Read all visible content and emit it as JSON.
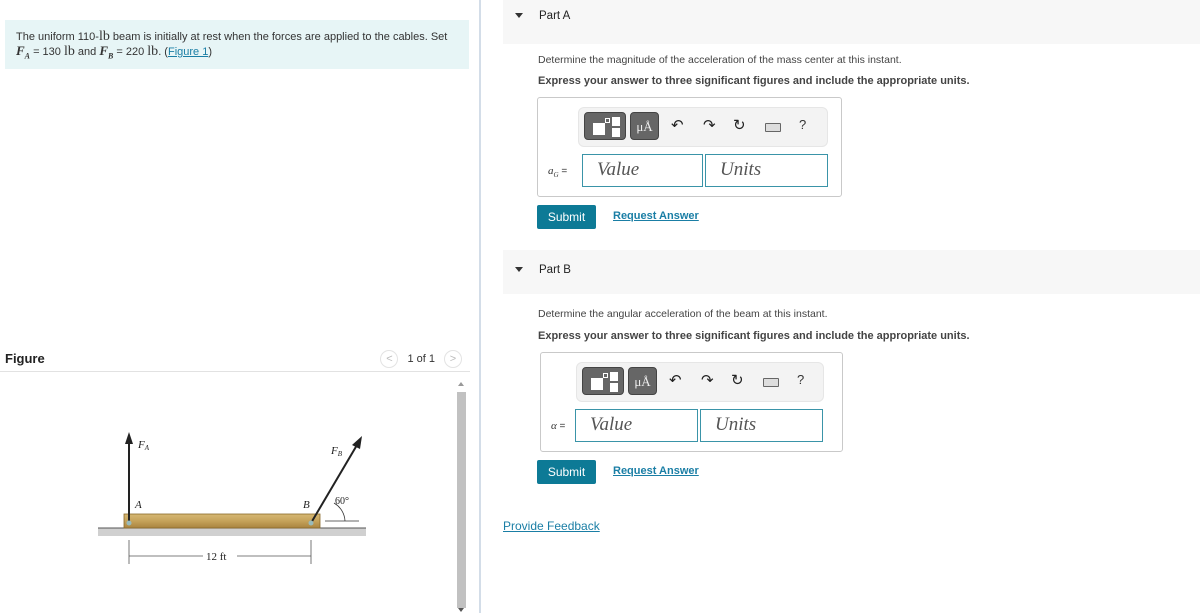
{
  "problem": {
    "text_1": "The uniform 110-",
    "unit_lb": "lb",
    "text_2": " beam is initially at rest when the forces are applied to the cables. Set",
    "fa_symbol": "F",
    "fa_sub": "A",
    "fa_value": " = 130 ",
    "fb_symbol": "F",
    "fb_sub": "B",
    "fb_value": " = 220 ",
    "and": " and ",
    "period": ". (",
    "figure_link": "Figure 1",
    "close": ")"
  },
  "figure": {
    "title": "Figure",
    "pager": "1 of 1",
    "prev_icon": "chevron-left-icon",
    "next_icon": "chevron-right-icon",
    "labels": {
      "fa": "F",
      "fa_sub": "A",
      "fb": "F",
      "fb_sub": "B",
      "point_a": "A",
      "point_b": "B",
      "angle": "60°",
      "length": "12 ft"
    }
  },
  "parts": [
    {
      "label": "Part A",
      "question": "Determine the magnitude of the acceleration of the mass center at this instant.",
      "instruction": "Express your answer to three significant figures and include the appropriate units.",
      "variable": "a",
      "variable_sub": "G",
      "equals": " =",
      "value_placeholder": "Value",
      "units_placeholder": "Units",
      "submit": "Submit",
      "request": "Request Answer"
    },
    {
      "label": "Part B",
      "question": "Determine the angular acceleration of the beam at this instant.",
      "instruction": "Express your answer to three significant figures and include the appropriate units.",
      "variable": "α",
      "variable_sub": "",
      "equals": " =",
      "value_placeholder": "Value",
      "units_placeholder": "Units",
      "submit": "Submit",
      "request": "Request Answer"
    }
  ],
  "toolbar": {
    "units_button": "μÅ",
    "undo": "↶",
    "redo": "↷",
    "reset": "↻",
    "help": "?"
  },
  "feedback": "Provide Feedback",
  "colors": {
    "accent": "#0d7a96",
    "link": "#1a7ea5",
    "problem_bg": "#e7f5f6",
    "part_header_bg": "#f7f7f7"
  }
}
